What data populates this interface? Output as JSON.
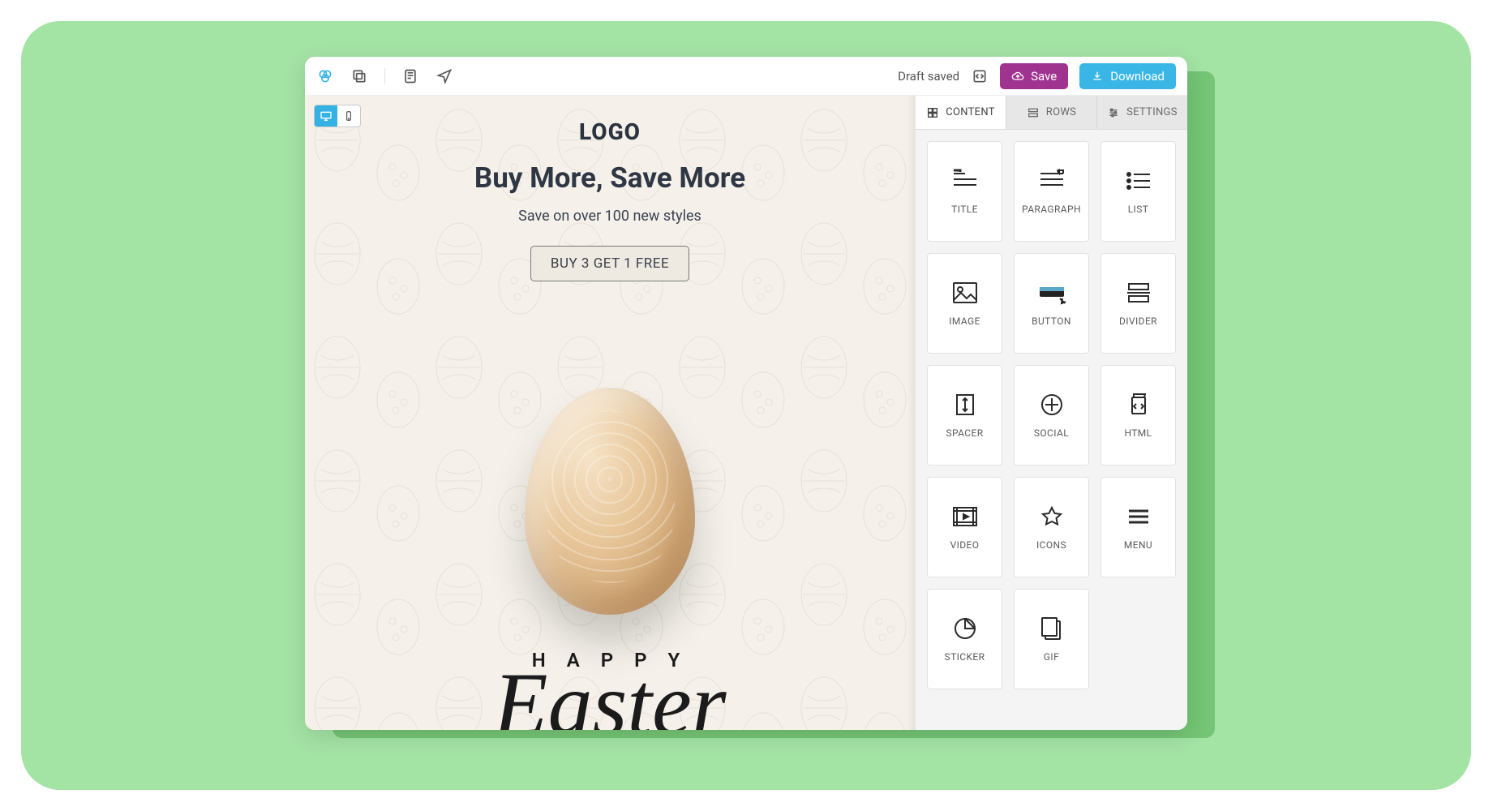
{
  "topbar": {
    "status": "Draft saved",
    "save_label": "Save",
    "download_label": "Download"
  },
  "canvas": {
    "logo_text": "LOGO",
    "headline": "Buy More, Save More",
    "subtext": "Save on over 100 new styles",
    "cta_label": "BUY 3 GET 1 FREE",
    "greeting_small": "H A P P Y",
    "greeting_script": "Easter"
  },
  "sidebar": {
    "tabs": [
      {
        "label": "CONTENT"
      },
      {
        "label": "ROWS"
      },
      {
        "label": "SETTINGS"
      }
    ],
    "content_tiles": [
      {
        "id": "title",
        "label": "TITLE"
      },
      {
        "id": "paragraph",
        "label": "PARAGRAPH"
      },
      {
        "id": "list",
        "label": "LIST"
      },
      {
        "id": "image",
        "label": "IMAGE"
      },
      {
        "id": "button",
        "label": "BUTTON"
      },
      {
        "id": "divider",
        "label": "DIVIDER"
      },
      {
        "id": "spacer",
        "label": "SPACER"
      },
      {
        "id": "social",
        "label": "SOCIAL"
      },
      {
        "id": "html",
        "label": "HTML"
      },
      {
        "id": "video",
        "label": "VIDEO"
      },
      {
        "id": "icons",
        "label": "ICONS"
      },
      {
        "id": "menu",
        "label": "MENU"
      },
      {
        "id": "sticker",
        "label": "STICKER"
      },
      {
        "id": "gif",
        "label": "GIF"
      }
    ]
  }
}
